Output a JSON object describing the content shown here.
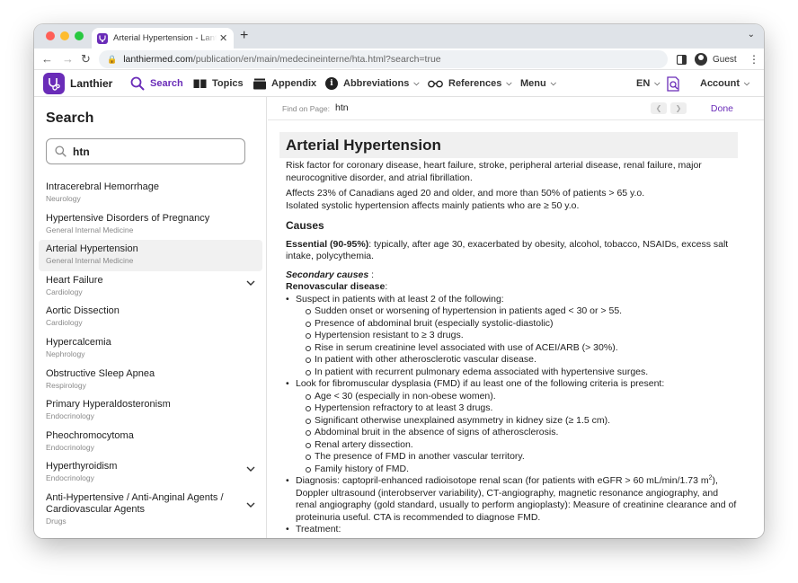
{
  "browser": {
    "tab_title": "Arterial Hypertension - Lanthier",
    "url_host": "lanthiermed.com",
    "url_path": "/publication/en/main/medecineinterne/hta.html?search=true",
    "profile_label": "Guest"
  },
  "nav": {
    "brand": "Lanthier",
    "search": "Search",
    "topics": "Topics",
    "appendix": "Appendix",
    "abbreviations": "Abbreviations",
    "references": "References",
    "menu": "Menu",
    "language": "EN",
    "account": "Account",
    "accent_color": "#6a2cb8"
  },
  "sidebar": {
    "title": "Search",
    "query": "htn",
    "results": [
      {
        "title": "Intracerebral Hemorrhage",
        "category": "Neurology",
        "expandable": false,
        "selected": false
      },
      {
        "title": "Hypertensive Disorders of Pregnancy",
        "category": "General Internal Medicine",
        "expandable": false,
        "selected": false
      },
      {
        "title": "Arterial Hypertension",
        "category": "General Internal Medicine",
        "expandable": false,
        "selected": true
      },
      {
        "title": "Heart Failure",
        "category": "Cardiology",
        "expandable": true,
        "selected": false
      },
      {
        "title": "Aortic Dissection",
        "category": "Cardiology",
        "expandable": false,
        "selected": false
      },
      {
        "title": "Hypercalcemia",
        "category": "Nephrology",
        "expandable": false,
        "selected": false
      },
      {
        "title": "Obstructive Sleep Apnea",
        "category": "Respirology",
        "expandable": false,
        "selected": false
      },
      {
        "title": "Primary Hyperaldosteronism",
        "category": "Endocrinology",
        "expandable": false,
        "selected": false
      },
      {
        "title": "Pheochromocytoma",
        "category": "Endocrinology",
        "expandable": false,
        "selected": false
      },
      {
        "title": "Hyperthyroidism",
        "category": "Endocrinology",
        "expandable": true,
        "selected": false
      },
      {
        "title": "Anti-Hypertensive / Anti-Anginal Agents / Cardiovascular Agents",
        "category": "Drugs",
        "expandable": true,
        "selected": false
      }
    ]
  },
  "findbar": {
    "label": "Find on Page:",
    "query": "htn",
    "done": "Done"
  },
  "article": {
    "title": "Arterial Hypertension",
    "intro1": "Risk factor for coronary disease, heart failure, stroke, peripheral arterial disease, renal failure, major neurocognitive disorder, and atrial fibrillation.",
    "intro2a": "Affects 23% of Canadians aged 20 and older, and more than 50% of patients > 65 y.o.",
    "intro2b": "Isolated systolic hypertension affects mainly patients who are ≥ 50 y.o.",
    "causes_heading": "Causes",
    "essential_label": "Essential (90-95%)",
    "essential_text": ": typically, after age 30, exacerbated by obesity, alcohol, tobacco, NSAIDs, excess salt intake, polycythemia.",
    "secondary_label": "Secondary causes",
    "secondary_colon": " :",
    "renovascular_label": "Renovascular disease",
    "renovascular_colon": ":",
    "suspect_intro": "Suspect in patients with at least 2 of the following:",
    "suspect_items": [
      "Sudden onset or worsening of hypertension in patients aged < 30 or > 55.",
      "Presence of abdominal bruit (especially systolic-diastolic)",
      "Hypertension resistant to ≥ 3 drugs.",
      "Rise in serum creatinine level associated with use of ACEI/ARB (> 30%).",
      "In patient with other atherosclerotic vascular disease.",
      "In patient with recurrent pulmonary edema associated with hypertensive surges."
    ],
    "fmd_intro": "Look for fibromuscular dysplasia (FMD) if au least one of the following criteria is present:",
    "fmd_items": [
      "Age < 30 (especially in non-obese women).",
      "Hypertension refractory to at least 3 drugs.",
      "Significant otherwise unexplained asymmetry in kidney size (≥ 1.5 cm).",
      "Abdominal bruit in the absence of signs of atherosclerosis.",
      "Renal artery dissection.",
      "The presence of FMD in another vascular territory.",
      "Family history of FMD."
    ],
    "diagnosis_a": "Diagnosis: captopril-enhanced radioisotope renal scan (for patients with eGFR > 60 mL/min/1.73 m",
    "diagnosis_sup": "2",
    "diagnosis_b": "), Doppler ultrasound (interobserver variability), CT-angiography, magnetic resonance angiography, and renal angiography (gold standard, usually to perform angioplasty): Measure of creatinine clearance and of proteinuria useful. CTA is recommended to diagnose FMD.",
    "treatment": "Treatment:"
  }
}
